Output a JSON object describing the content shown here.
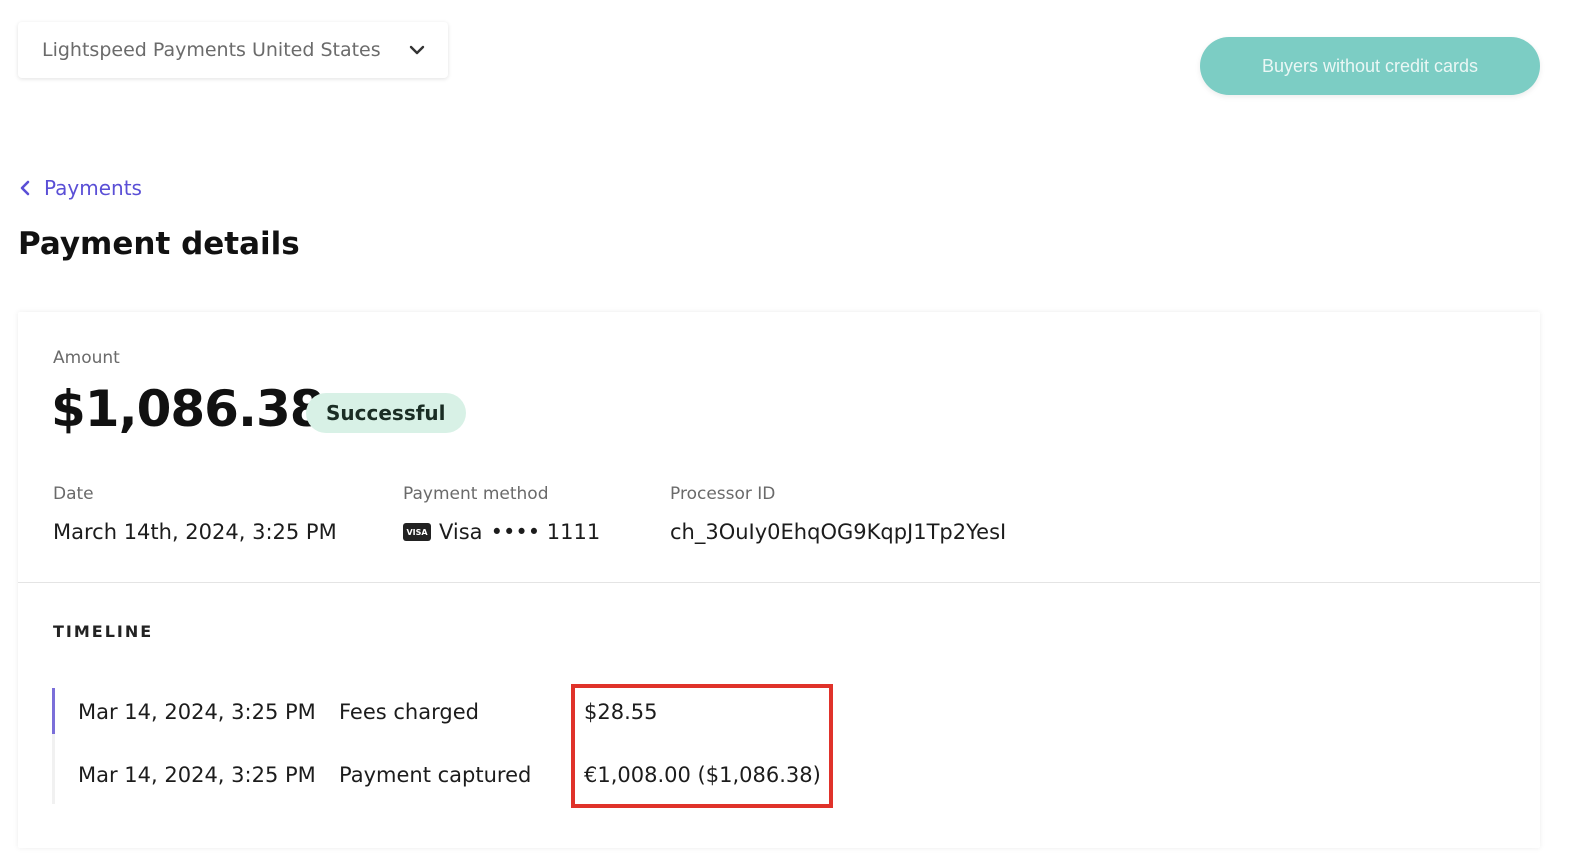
{
  "header": {
    "account_selector": "Lightspeed Payments United States",
    "cta_button": "Buyers without credit cards"
  },
  "breadcrumb": {
    "back_label": "Payments"
  },
  "page_title": "Payment details",
  "summary": {
    "amount_label": "Amount",
    "amount_value": "$1,086.38",
    "status": "Successful",
    "date_label": "Date",
    "date_value": "March 14th, 2024, 3:25 PM",
    "method_label": "Payment method",
    "method_brand": "Visa",
    "method_masked": "•••• 1111",
    "card_icon_text": "VISA",
    "processor_label": "Processor ID",
    "processor_value": "ch_3OuIy0EhqOG9KqpJ1Tp2YesI"
  },
  "timeline": {
    "heading": "TIMELINE",
    "rows": [
      {
        "date": "Mar 14, 2024, 3:25 PM",
        "event": "Fees charged",
        "amount": "$28.55"
      },
      {
        "date": "Mar 14, 2024, 3:25 PM",
        "event": "Payment captured",
        "amount": "€1,008.00 ($1,086.38)"
      }
    ]
  },
  "colors": {
    "accent_link": "#5a4fd6",
    "cta": "#7ccdc4",
    "status_bg": "#d8f1e6",
    "highlight": "#e0322a"
  },
  "icons": {
    "selector": "chevron-down-icon",
    "breadcrumb": "chevron-left-icon",
    "payment_method": "visa-card-icon"
  }
}
